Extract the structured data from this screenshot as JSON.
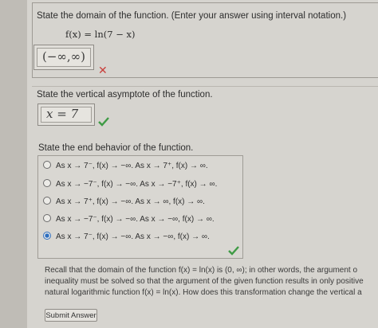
{
  "q1": {
    "prompt": "State the domain of the function. (Enter your answer using interval notation.)",
    "function": "f(x) = ln(7 − x)",
    "answer": "(−∞,∞)"
  },
  "q2": {
    "prompt": "State the vertical asymptote of the function.",
    "answer": "x = 7"
  },
  "q3": {
    "prompt": "State the end behavior of the function.",
    "options": [
      "As x → 7⁻, f(x) → −∞. As x → 7⁺, f(x) → ∞.",
      "As x → −7⁻, f(x) → −∞. As x → −7⁺, f(x) → ∞.",
      "As x → 7⁺, f(x) → −∞. As x → ∞, f(x) → ∞.",
      "As x → −7⁻, f(x) → −∞. As x → −∞, f(x) → ∞.",
      "As x → 7⁻, f(x) → −∞. As x → −∞, f(x) → ∞."
    ],
    "selected_index": 4
  },
  "hint": {
    "line1": "Recall that the domain of the function  f(x) = ln(x)  is (0, ∞); in other words, the argument o",
    "line2": "inequality must be solved so that the argument of the given function results in only positive",
    "line3": "natural logarithmic function  f(x) = ln(x).  How does this transformation change the vertical a"
  },
  "submit_label": "Submit Answer",
  "colors": {
    "wrong": "#c9403c",
    "correct": "#3f9b45",
    "radio_selected": "#2f6fc0"
  }
}
